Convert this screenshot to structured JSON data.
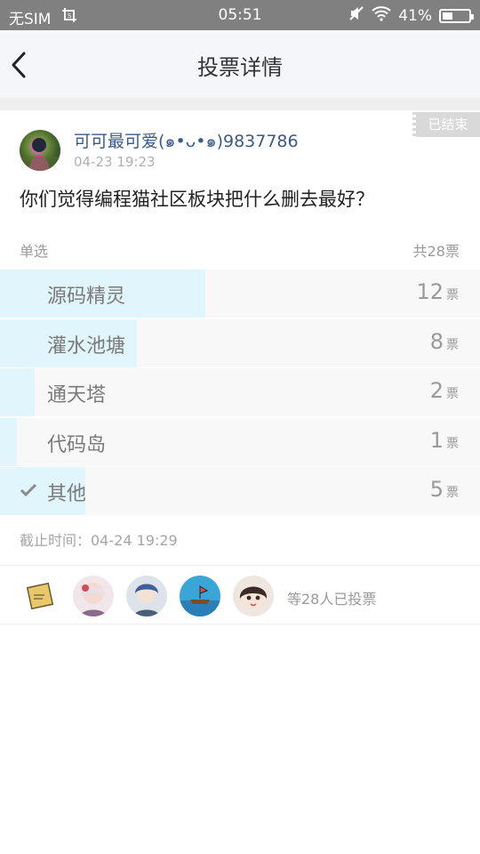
{
  "status_bar": {
    "carrier": "无SIM",
    "time": "05:51",
    "battery": "41%",
    "battery_level": 0.41
  },
  "nav": {
    "title": "投票详情"
  },
  "poll": {
    "ended_badge": "已结束",
    "author": "可可最可爱(๑•ᴗ•๑)9837786",
    "post_time": "04-23 19:23",
    "question": "你们觉得编程猫社区板块把什么删去最好？",
    "mode": "单选",
    "total": "共28票",
    "vote_unit": "票",
    "options": [
      {
        "label": "源码精灵",
        "votes": "12",
        "share": 0.4286,
        "selected": false
      },
      {
        "label": "灌水池塘",
        "votes": "8",
        "share": 0.2857,
        "selected": false
      },
      {
        "label": "通天塔",
        "votes": "2",
        "share": 0.0714,
        "selected": false
      },
      {
        "label": "代码岛",
        "votes": "1",
        "share": 0.0357,
        "selected": false
      },
      {
        "label": "其他",
        "votes": "5",
        "share": 0.1786,
        "selected": true
      }
    ],
    "deadline": "截止时间：04-24 19:29"
  },
  "voters": {
    "summary": "等28人已投票",
    "avatars": [
      "stamp-avatar",
      "anime-girl-avatar",
      "blue-hair-avatar",
      "boat-avatar",
      "anime-face-avatar"
    ]
  },
  "colors": {
    "fill": "#e0f5fc",
    "username": "#3a5a8c",
    "statusbar": "#808080"
  }
}
